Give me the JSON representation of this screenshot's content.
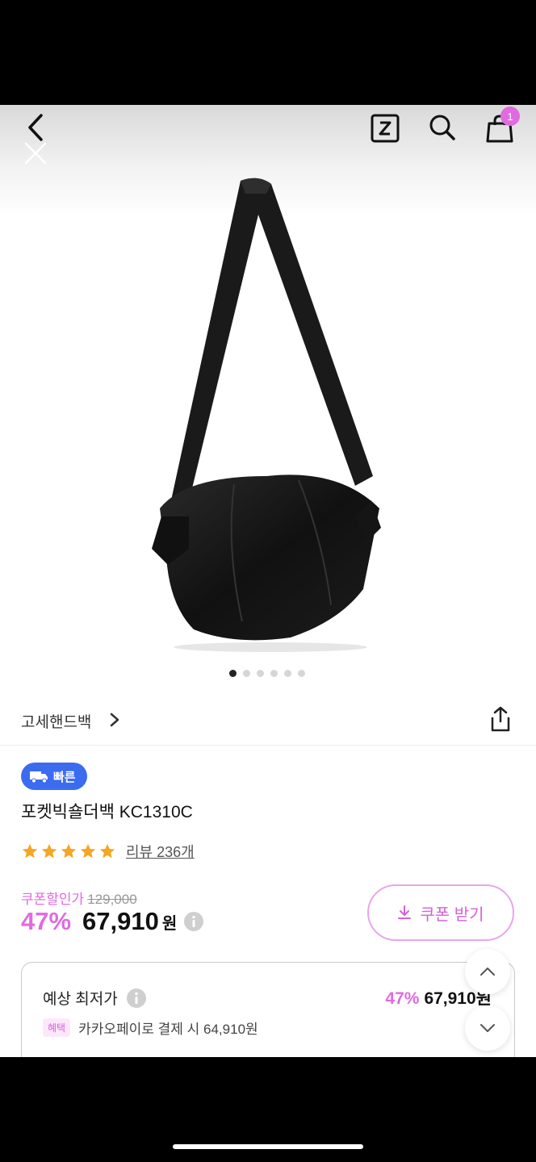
{
  "header": {
    "icons": [
      "back-icon",
      "close-icon",
      "zigzag-logo-icon",
      "search-icon",
      "shopping-bag-icon"
    ],
    "cart_count": "1"
  },
  "gallery": {
    "image_count": 6,
    "active_index": 0
  },
  "store": {
    "name": "고세핸드백"
  },
  "product": {
    "badge_label": "빠른",
    "name": "포켓빅숄더백 KC1310C",
    "rating_stars": 5,
    "review_text": "리뷰 236개"
  },
  "pricing": {
    "coupon_price_label": "쿠폰할인가",
    "original_price": "129,000",
    "discount_percent": "47%",
    "price": "67,910",
    "currency": "원",
    "coupon_button_label": "쿠폰 받기"
  },
  "lowest_price": {
    "title": "예상 최저가",
    "discount_percent": "47%",
    "price": "67,910원",
    "benefit_tag": "혜택",
    "benefit_text": "카카오페이로 결제 시 64,910원"
  },
  "colors": {
    "accent_pink": "#e06be0",
    "badge_blue": "#3b6cf0",
    "star_orange": "#f5a623"
  }
}
